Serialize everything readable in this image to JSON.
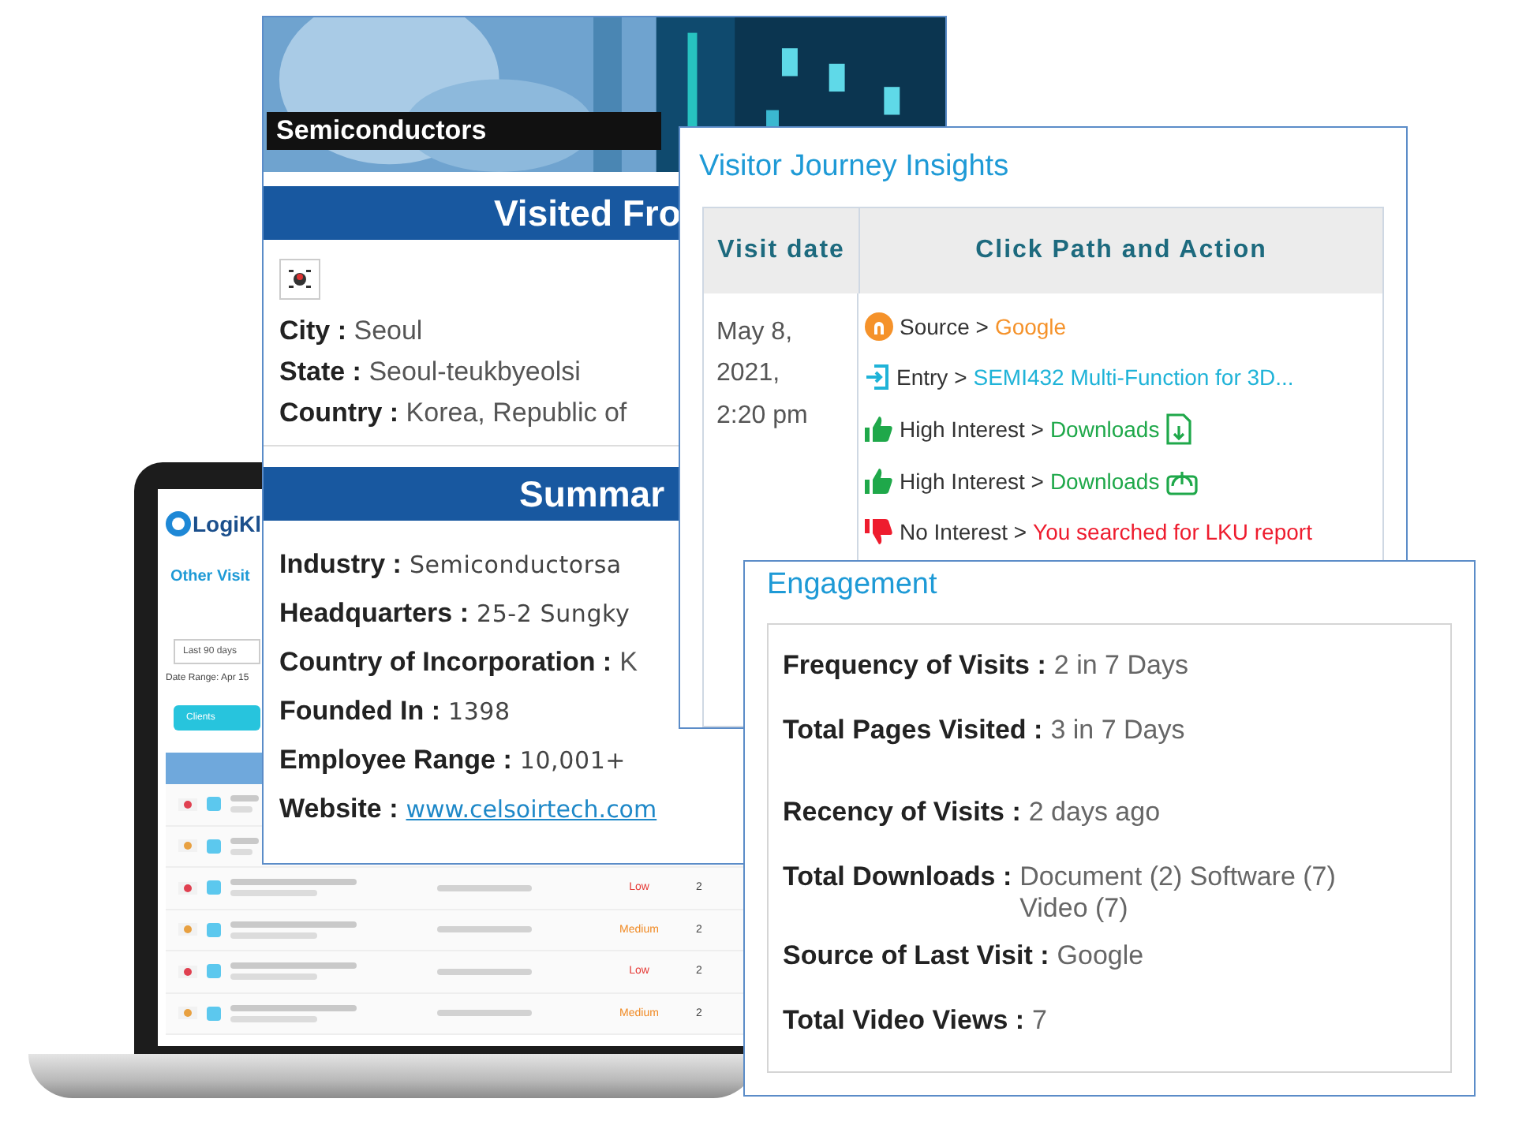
{
  "laptop": {
    "logo": "LogiKl",
    "heading": "Other Visit",
    "range_select": "Last 90 days",
    "date_range": "Date Range: Apr 15",
    "tab": "Clients",
    "rows": [
      {
        "kind": "covered"
      },
      {
        "kind": "covered"
      },
      {
        "kind": "entry",
        "rating": "Low",
        "color": "#e53935",
        "count": "2"
      },
      {
        "kind": "entry",
        "rating": "Medium",
        "color": "#f08a24",
        "count": "2"
      },
      {
        "kind": "entry",
        "rating": "Low",
        "color": "#e53935",
        "count": "2"
      },
      {
        "kind": "entry",
        "rating": "Medium",
        "color": "#f08a24",
        "count": "2"
      }
    ]
  },
  "company_card": {
    "category": "Semiconductors",
    "visited_heading": "Visited Fro",
    "location": [
      {
        "label": "City :",
        "value": "Seoul"
      },
      {
        "label": "State :",
        "value": "Seoul-teukbyeolsi"
      },
      {
        "label": "Country :",
        "value": "Korea, Republic of"
      }
    ],
    "summary_heading": "Summar",
    "summary": [
      {
        "label": "Industry :",
        "value": "Semiconductorsa",
        "kind": "wide"
      },
      {
        "label": "Headquarters :",
        "value": "25-2 Sungky",
        "kind": "wide"
      },
      {
        "label": "Country of Incorporation :",
        "value": "K",
        "kind": "plain"
      },
      {
        "label": "Founded In :",
        "value": "1398",
        "kind": "wide"
      },
      {
        "label": "Employee Range :",
        "value": "10,001+",
        "kind": "wide"
      },
      {
        "label": "Website :",
        "value": "www.celsoirtech.com",
        "kind": "link"
      }
    ]
  },
  "journey_card": {
    "title": "Visitor Journey Insights",
    "columns": [
      "Visit date",
      "Click Path and Action"
    ],
    "visit_date": "May 8, 2021, 2:20 pm",
    "path": [
      {
        "kind": "source",
        "label": "Source >",
        "value": "Google"
      },
      {
        "kind": "entry",
        "label": "Entry >",
        "value": "SEMI432 Multi-Function for 3D..."
      },
      {
        "kind": "high_document",
        "label": "High Interest >",
        "value": "Downloads"
      },
      {
        "kind": "high_software",
        "label": "High Interest >",
        "value": "Downloads"
      },
      {
        "kind": "no",
        "label": "No Interest >",
        "value": "You searched for LKU report"
      }
    ]
  },
  "engagement_card": {
    "title": "Engagement",
    "items": [
      {
        "label": "Frequency of Visits :",
        "value": "2 in 7 Days"
      },
      {
        "label": "Total Pages Visited :",
        "value": "3 in 7 Days"
      },
      {
        "label": "Recency of Visits :",
        "value": "2 days ago"
      },
      {
        "label": "Total Downloads :",
        "value": "Document (2) Software (7) Video (7)"
      },
      {
        "label": "Source of Last Visit :",
        "value": "Google"
      },
      {
        "label": "Total Video Views :",
        "value": "7"
      }
    ]
  }
}
